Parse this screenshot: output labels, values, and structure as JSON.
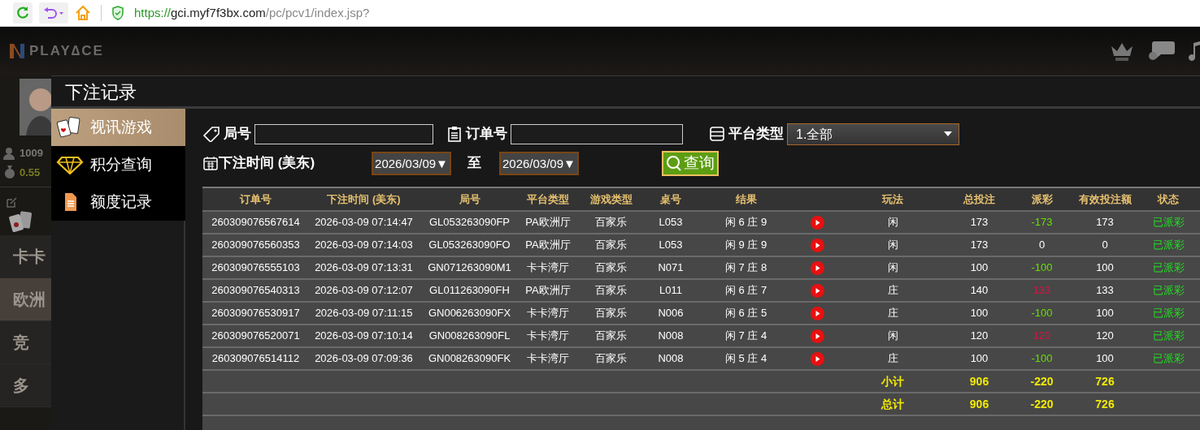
{
  "browser": {
    "url_scheme": "https://",
    "url_host": "gci.myf7f3bx.com",
    "url_path": "/pc/pcv1/index.jsp?"
  },
  "background": {
    "logo": "PLAY∆CE",
    "user_id": "1009",
    "balance": "0.55",
    "menu": [
      "卡卡",
      "欧洲",
      "竞",
      "多"
    ]
  },
  "modal": {
    "title": "下注记录",
    "menu": [
      {
        "label": "视讯游戏",
        "selected": true
      },
      {
        "label": "积分查询",
        "selected": false
      },
      {
        "label": "额度记录",
        "selected": false
      }
    ],
    "filters": {
      "round_label": "局号",
      "order_label": "订单号",
      "platform_label": "平台类型",
      "platform_value": "1.全部",
      "time_label": "下注时间 (美东)",
      "date_from": "2026/03/09▼",
      "to_label": "至",
      "date_to": "2026/03/09▼",
      "query_button": "查询"
    },
    "table": {
      "columns": [
        "订单号",
        "下注时间 (美东)",
        "局号",
        "平台类型",
        "游戏类型",
        "桌号",
        "结果",
        "玩法",
        "总投注",
        "派彩",
        "有效投注额",
        "状态"
      ],
      "rows": [
        {
          "order": "260309076567614",
          "time": "2026-03-09 07:14:47",
          "round": "GL053263090FP",
          "platform": "PA欧洲厅",
          "game": "百家乐",
          "table": "L053",
          "result": "闲 6 庄 9",
          "play": "闲",
          "bet": "173",
          "payout": {
            "text": "-173",
            "color": "#66e000"
          },
          "valid": "173",
          "status": "已派彩"
        },
        {
          "order": "260309076560353",
          "time": "2026-03-09 07:14:03",
          "round": "GL053263090FO",
          "platform": "PA欧洲厅",
          "game": "百家乐",
          "table": "L053",
          "result": "闲 9 庄 9",
          "play": "闲",
          "bet": "173",
          "payout": {
            "text": "0",
            "color": "#ffffff"
          },
          "valid": "0",
          "status": "已派彩"
        },
        {
          "order": "260309076555103",
          "time": "2026-03-09 07:13:31",
          "round": "GN071263090M1",
          "platform": "卡卡湾厅",
          "game": "百家乐",
          "table": "N071",
          "result": "闲 7 庄 8",
          "play": "闲",
          "bet": "100",
          "payout": {
            "text": "-100",
            "color": "#66e000"
          },
          "valid": "100",
          "status": "已派彩"
        },
        {
          "order": "260309076540313",
          "time": "2026-03-09 07:12:07",
          "round": "GL011263090FH",
          "platform": "PA欧洲厅",
          "game": "百家乐",
          "table": "L011",
          "result": "闲 6 庄 7",
          "play": "庄",
          "bet": "140",
          "payout": {
            "text": "133",
            "color": "#dd1144"
          },
          "valid": "133",
          "status": "已派彩"
        },
        {
          "order": "260309076530917",
          "time": "2026-03-09 07:11:15",
          "round": "GN006263090FX",
          "platform": "卡卡湾厅",
          "game": "百家乐",
          "table": "N006",
          "result": "闲 6 庄 5",
          "play": "庄",
          "bet": "100",
          "payout": {
            "text": "-100",
            "color": "#66e000"
          },
          "valid": "100",
          "status": "已派彩"
        },
        {
          "order": "260309076520071",
          "time": "2026-03-09 07:10:14",
          "round": "GN008263090FL",
          "platform": "卡卡湾厅",
          "game": "百家乐",
          "table": "N008",
          "result": "闲 7 庄 4",
          "play": "闲",
          "bet": "120",
          "payout": {
            "text": "120",
            "color": "#dd1144"
          },
          "valid": "120",
          "status": "已派彩"
        },
        {
          "order": "260309076514112",
          "time": "2026-03-09 07:09:36",
          "round": "GN008263090FK",
          "platform": "卡卡湾厅",
          "game": "百家乐",
          "table": "N008",
          "result": "闲 5 庄 4",
          "play": "庄",
          "bet": "100",
          "payout": {
            "text": "-100",
            "color": "#66e000"
          },
          "valid": "100",
          "status": "已派彩"
        }
      ],
      "totals": [
        {
          "label": "小计",
          "bet": "906",
          "payout": "-220",
          "valid": "726"
        },
        {
          "label": "总计",
          "bet": "906",
          "payout": "-220",
          "valid": "726"
        }
      ]
    }
  }
}
